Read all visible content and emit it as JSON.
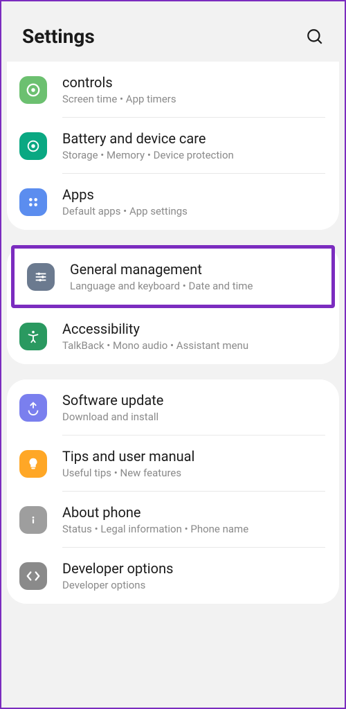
{
  "header": {
    "title": "Settings"
  },
  "groups": [
    {
      "items": [
        {
          "key": "controls",
          "title": "controls",
          "subtitle": "Screen time  •  App timers"
        },
        {
          "key": "battery",
          "title": "Battery and device care",
          "subtitle": "Storage  •  Memory  •  Device protection"
        },
        {
          "key": "apps",
          "title": "Apps",
          "subtitle": "Default apps  •  App settings"
        }
      ]
    },
    {
      "items": [
        {
          "key": "general",
          "title": "General management",
          "subtitle": "Language and keyboard  •  Date and time",
          "highlighted": true
        },
        {
          "key": "accessibility",
          "title": "Accessibility",
          "subtitle": "TalkBack  •  Mono audio  •  Assistant menu"
        }
      ]
    },
    {
      "items": [
        {
          "key": "software",
          "title": "Software update",
          "subtitle": "Download and install"
        },
        {
          "key": "tips",
          "title": "Tips and user manual",
          "subtitle": "Useful tips  •  New features"
        },
        {
          "key": "about",
          "title": "About phone",
          "subtitle": "Status  •  Legal information  •  Phone name"
        },
        {
          "key": "developer",
          "title": "Developer options",
          "subtitle": "Developer options"
        }
      ]
    }
  ]
}
